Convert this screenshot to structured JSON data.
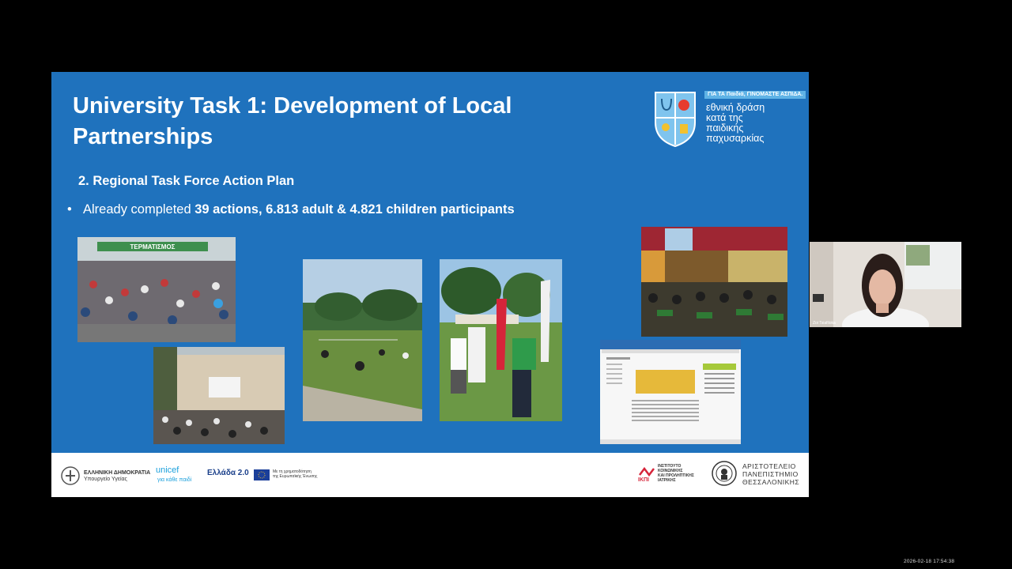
{
  "slide": {
    "title": "University Task 1: Development of Local Partnerships",
    "subtitle": "2. Regional Task Force Action Plan",
    "bullet": {
      "marker": "•",
      "prefix": "Already  completed ",
      "highlight": "39 actions, 6.813 adult  & 4.821 children participants"
    },
    "logo": {
      "tagline": "ΓΙΑ ΤΑ Παιδιά, ΓΙΝΟΜΑΣΤΕ ΑΣΠΙΔΑ.",
      "line1": "εθνική δράση",
      "line2": "κατά της",
      "line3": "παιδικής",
      "line4": "παχυσαρκίας"
    },
    "photos": {
      "race_banner": "ΤΕΡΜΑΤΙΣΜΟΣ"
    },
    "footer": {
      "republic": "ΕΛΛΗΝΙΚΗ ΔΗΜΟΚΡΑΤΙΑ",
      "ministry": "Υπουργείο Υγείας",
      "unicef": "unicef",
      "unicef_sub": "για κάθε παιδί",
      "greece20": "Ελλάδα 2.0",
      "eu_text1": "Με τη χρηματοδότηση",
      "eu_text2": "της Ευρωπαϊκής Ένωσης",
      "ikpi1": "ΙΝΣΤΙΤΟΥΤΟ",
      "ikpi2": "ΚΟΙΝΩΝΙΚΗΣ",
      "ikpi3": "ΚΑΙ ΠΡΟΛΗΠΤΙΚΗΣ",
      "ikpi4": "ΙΑΤΡΙΚΗΣ",
      "ikpi_abbr": "ΙΚΠΙ",
      "auth1": "ΑΡΙΣΤΟΤΕΛΕΙΟ",
      "auth2": "ΠΑΝΕΠΙΣΤΗΜΙΟ",
      "auth3": "ΘΕΣΣΑΛΟΝΙΚΗΣ"
    }
  },
  "video": {
    "participant_name": "Zoi Tsiafiloka"
  },
  "timestamp": "2026-02-18  17:54:38",
  "colors": {
    "slide_bg": "#1f72bd",
    "background": "#000000",
    "footer_bg": "#ffffff"
  }
}
